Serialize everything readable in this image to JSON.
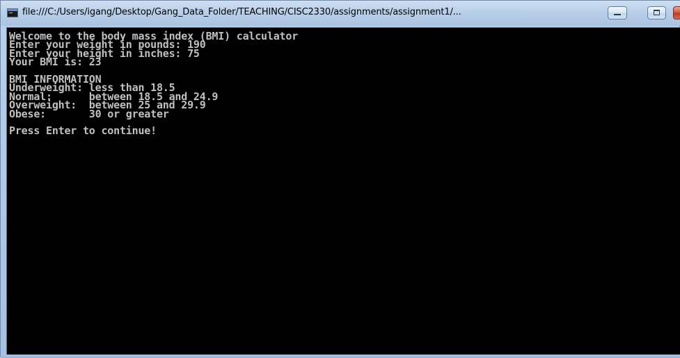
{
  "window": {
    "title": "file:///C:/Users/igang/Desktop/Gang_Data_Folder/TEACHING/CISC2330/assignments/assignment1/...",
    "icon": "console-app-icon",
    "controls": {
      "minimize": "minimize-icon",
      "maximize": "maximize-icon",
      "close": "close-icon"
    }
  },
  "console": {
    "background": "#000000",
    "foreground": "#c0c0c0",
    "lines": [
      "Welcome to the body mass index (BMI) calculator",
      "Enter your weight in pounds: 190",
      "Enter your height in inches: 75",
      "Your BMI is: 23",
      "",
      "BMI INFORMATION",
      "Underweight: less than 18.5",
      "Normal:      between 18.5 and 24.9",
      "Overweight:  between 25 and 29.9",
      "Obese:       30 or greater",
      "",
      "Press Enter to continue!"
    ]
  }
}
